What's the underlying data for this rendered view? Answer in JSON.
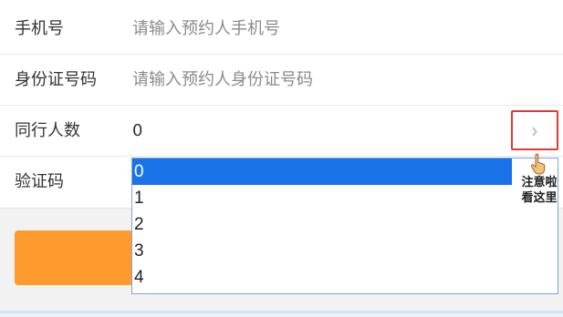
{
  "form": {
    "phone_label": "手机号",
    "phone_placeholder": "请输入预约人手机号",
    "idcard_label": "身份证号码",
    "idcard_placeholder": "请输入预约人身份证号码",
    "companions_label": "同行人数",
    "companions_value": "0",
    "captcha_label": "验证码"
  },
  "dropdown": {
    "options": [
      "0",
      "1",
      "2",
      "3",
      "4"
    ],
    "selected": "0"
  },
  "annotation": {
    "line1": "注意啦",
    "line2": "看这里"
  },
  "icons": {
    "chevron": "chevron-right-icon",
    "hand": "pointing-hand-icon"
  },
  "colors": {
    "accent": "#ff9a2e",
    "highlight": "#e53935",
    "selected_option": "#1a73e8"
  }
}
